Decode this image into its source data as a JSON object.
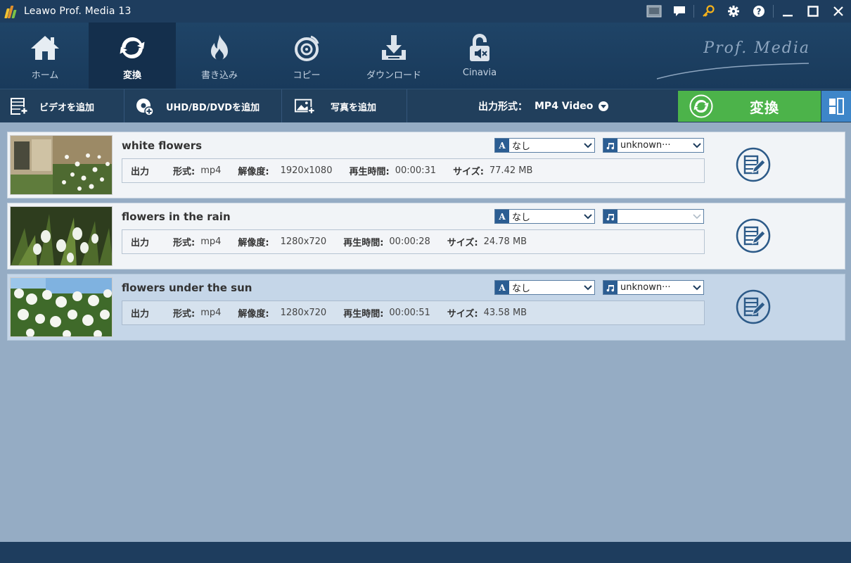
{
  "window": {
    "title": "Leawo Prof. Media 13"
  },
  "title_icons": [
    "screen-icon",
    "chat-icon",
    "key-icon",
    "settings-icon",
    "help-icon",
    "minimize-icon",
    "maximize-icon",
    "close-icon"
  ],
  "nav": {
    "items": [
      {
        "label": "ホーム",
        "icon": "home-icon",
        "active": false
      },
      {
        "label": "変換",
        "icon": "convert-icon",
        "active": true
      },
      {
        "label": "書き込み",
        "icon": "burn-icon",
        "active": false
      },
      {
        "label": "コピー",
        "icon": "copy-disc-icon",
        "active": false
      },
      {
        "label": "ダウンロード",
        "icon": "download-icon",
        "active": false
      },
      {
        "label": "Cinavia",
        "icon": "cinavia-icon",
        "active": false
      }
    ],
    "brand": "Prof. Media"
  },
  "toolbar": {
    "add_video": "ビデオを追加",
    "add_disc": "UHD/BD/DVDを追加",
    "add_photo": "写真を追加",
    "output_format_label": "出力形式：",
    "output_format_value": "MP4 Video",
    "convert_label": "変換"
  },
  "labels": {
    "output": "出力",
    "format": "形式:",
    "resolution": "解像度:",
    "duration": "再生時間:",
    "size": "サイズ:"
  },
  "files": [
    {
      "name": "white flowers",
      "format": "mp4",
      "resolution": "1920x1080",
      "duration": "00:00:31",
      "size": "77.42 MB",
      "subtitle": "なし",
      "audio": "unknown···",
      "selected": false
    },
    {
      "name": "flowers in the rain",
      "format": "mp4",
      "resolution": "1280x720",
      "duration": "00:00:28",
      "size": "24.78 MB",
      "subtitle": "なし",
      "audio": "",
      "selected": false
    },
    {
      "name": "flowers under the sun",
      "format": "mp4",
      "resolution": "1280x720",
      "duration": "00:00:51",
      "size": "43.58 MB",
      "subtitle": "なし",
      "audio": "unknown···",
      "selected": true
    }
  ],
  "colors": {
    "titlebar": "#1e3d5e",
    "convert": "#4cb34a",
    "panel": "#3e86c9",
    "list_bg": "#95acc4"
  }
}
